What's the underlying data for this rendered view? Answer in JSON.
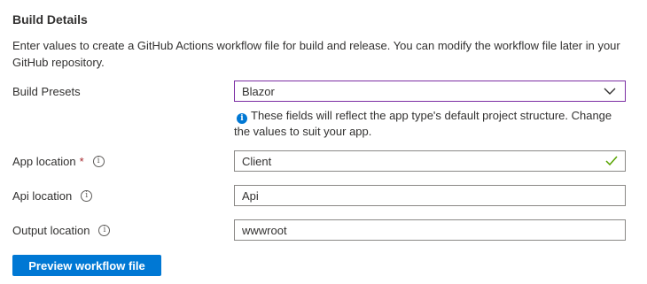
{
  "section": {
    "title": "Build Details",
    "description": "Enter values to create a GitHub Actions workflow file for build and release. You can modify the workflow file later in your GitHub repository."
  },
  "fields": {
    "build_presets": {
      "label": "Build Presets",
      "value": "Blazor",
      "hint": "These fields will reflect the app type's default project structure. Change the values to suit your app."
    },
    "app_location": {
      "label": "App location",
      "required_marker": "*",
      "value": "Client",
      "valid": true
    },
    "api_location": {
      "label": "Api location",
      "value": "Api"
    },
    "output_location": {
      "label": "Output location",
      "value": "wwwroot"
    }
  },
  "actions": {
    "preview_label": "Preview workflow file"
  },
  "icons": {
    "info": "info-icon",
    "hint": "info-filled-icon",
    "dropdown": "chevron-down-icon",
    "valid": "checkmark-icon"
  },
  "colors": {
    "primary": "#0078d4",
    "focus_border": "#7b2ea3",
    "valid": "#57a300",
    "required": "#a4262c"
  }
}
